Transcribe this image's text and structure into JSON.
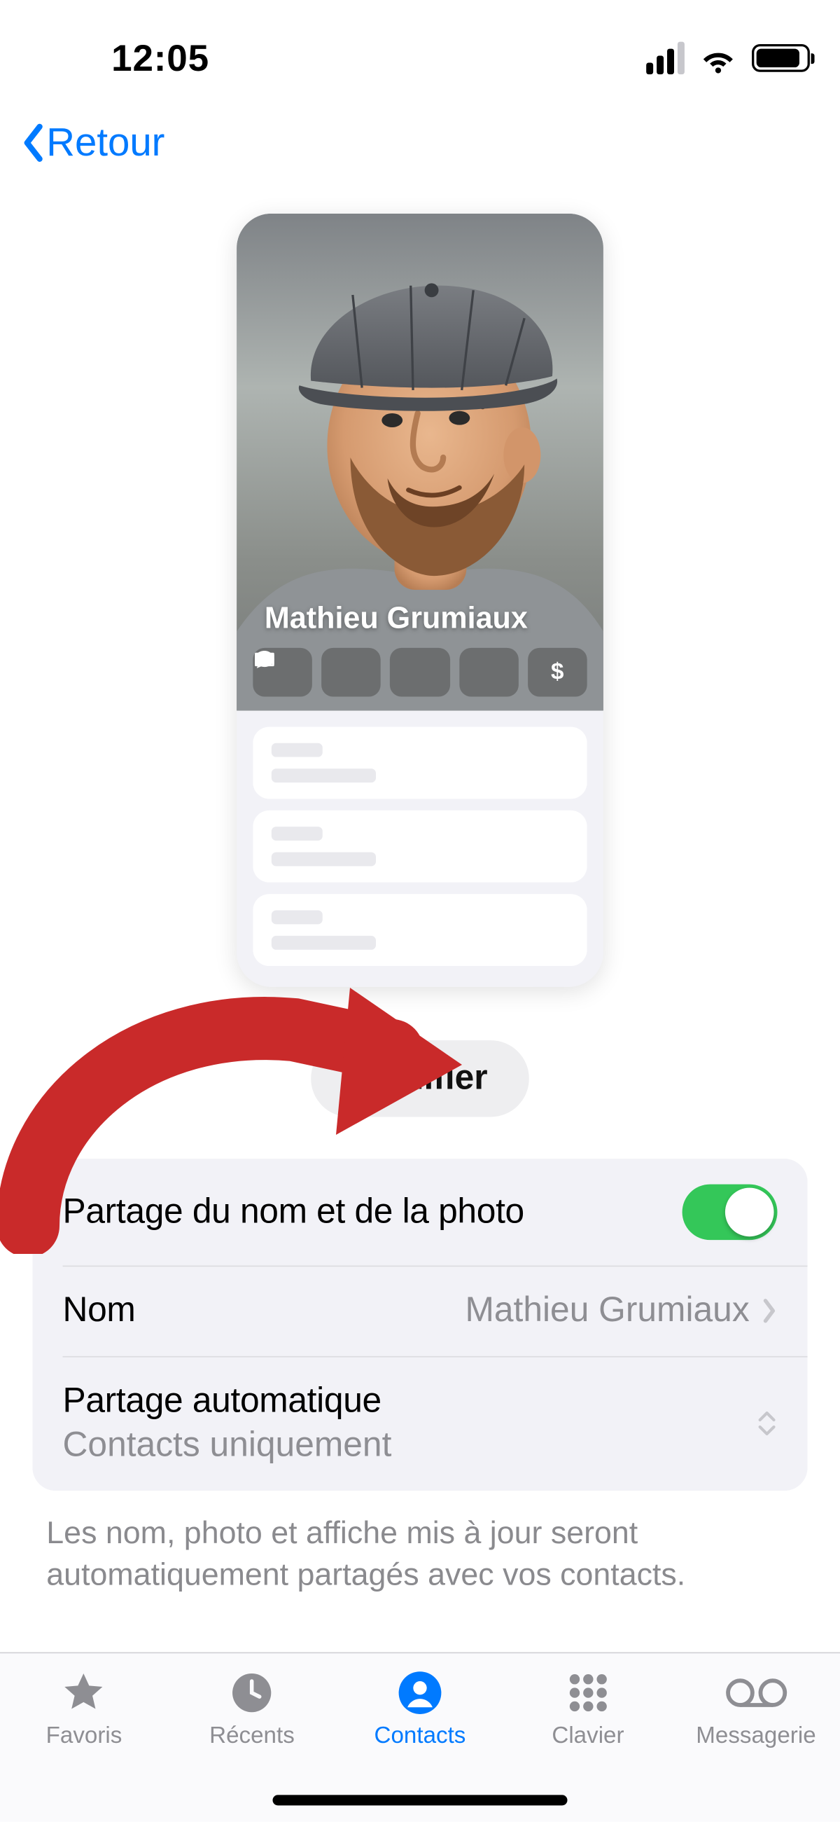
{
  "status": {
    "time": "12:05"
  },
  "nav": {
    "back_label": "Retour"
  },
  "card": {
    "name": "Mathieu Grumiaux"
  },
  "buttons": {
    "modify": "Modifier"
  },
  "settings": {
    "share_name_photo": {
      "label": "Partage du nom et de la photo",
      "on": true
    },
    "name": {
      "label": "Nom",
      "value": "Mathieu Grumiaux"
    },
    "auto_share": {
      "label": "Partage automatique",
      "value": "Contacts uniquement"
    }
  },
  "footer_note": "Les nom, photo et affiche mis à jour seront automatiquement partagés avec vos contacts.",
  "tabs": {
    "favorites": "Favoris",
    "recents": "Récents",
    "contacts": "Contacts",
    "keypad": "Clavier",
    "voicemail": "Messagerie"
  }
}
